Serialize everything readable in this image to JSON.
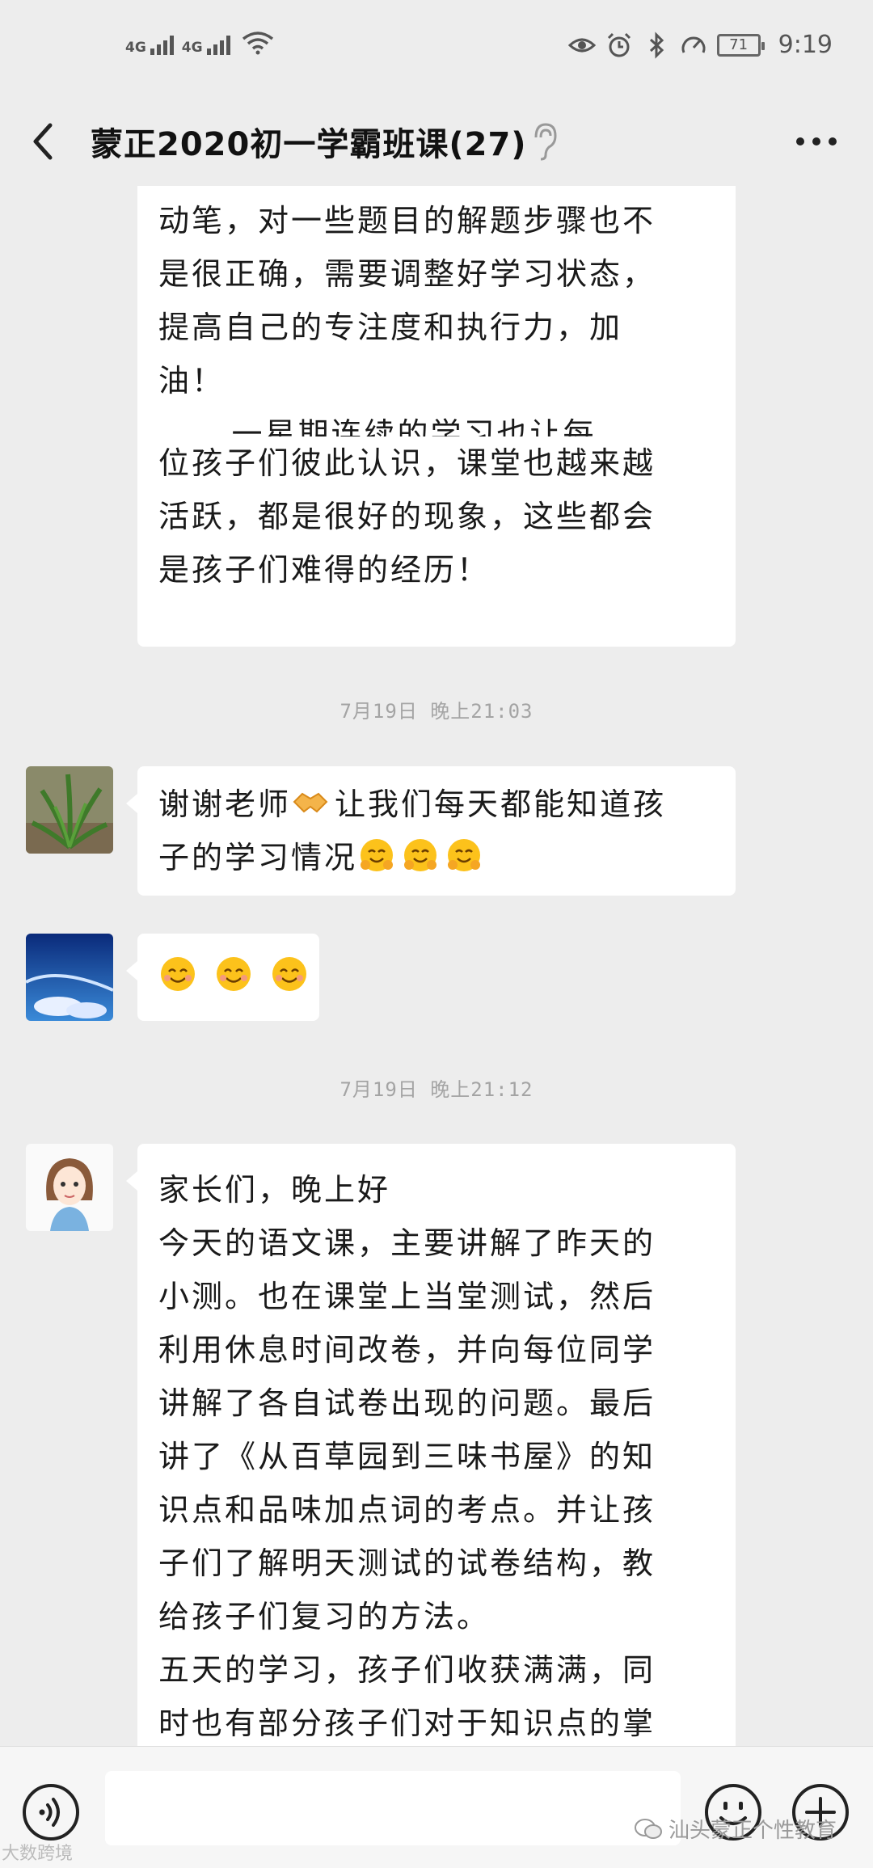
{
  "status_bar": {
    "signal1_label": "4G",
    "signal2_label": "4G",
    "battery": "71",
    "time": "9:19"
  },
  "header": {
    "title": "蒙正2020初一学霸班课(27)"
  },
  "messages": {
    "m1": {
      "lines": [
        "动笔，对一些题目的解题步骤也不",
        "是很正确，需要调整好学习状态，",
        "提高自己的专注度和执行力，加",
        "油！",
        "      一星期连续的学习也让每",
        "位孩子们彼此认识，课堂也越来越",
        "活跃，都是很好的现象，这些都会",
        "是孩子们难得的经历！"
      ]
    },
    "ts1": "7月19日 晚上21:03",
    "m2": {
      "line1_a": "谢谢老师",
      "line1_b": "让我们每天都能知道孩",
      "line2": "子的学习情况"
    },
    "ts2": "7月19日 晚上21:12",
    "m4": {
      "lines": [
        "家长们，晚上好",
        "今天的语文课，主要讲解了昨天的",
        "小测。也在课堂上当堂测试，然后",
        "利用休息时间改卷，并向每位同学",
        "讲解了各自试卷出现的问题。最后",
        "讲了《从百草园到三味书屋》的知",
        "识点和品味加点词的考点。并让孩",
        "子们了解明天测试的试卷结构，教",
        "给孩子们复习的方法。",
        "五天的学习，孩子们收获满满，同",
        "时也有部分孩子们对于知识点的掌"
      ]
    }
  },
  "watermarks": {
    "left": "大数跨境",
    "right": "汕头蒙正个性教育"
  },
  "icons": {
    "back": "back-arrow-icon",
    "ear": "ear-icon",
    "more": "more-icon",
    "voice": "voice-icon",
    "emoji": "emoji-icon",
    "plus": "plus-icon"
  },
  "colors": {
    "background": "#ededed",
    "bubble": "#ffffff",
    "timestamp": "#a4a4a4"
  }
}
